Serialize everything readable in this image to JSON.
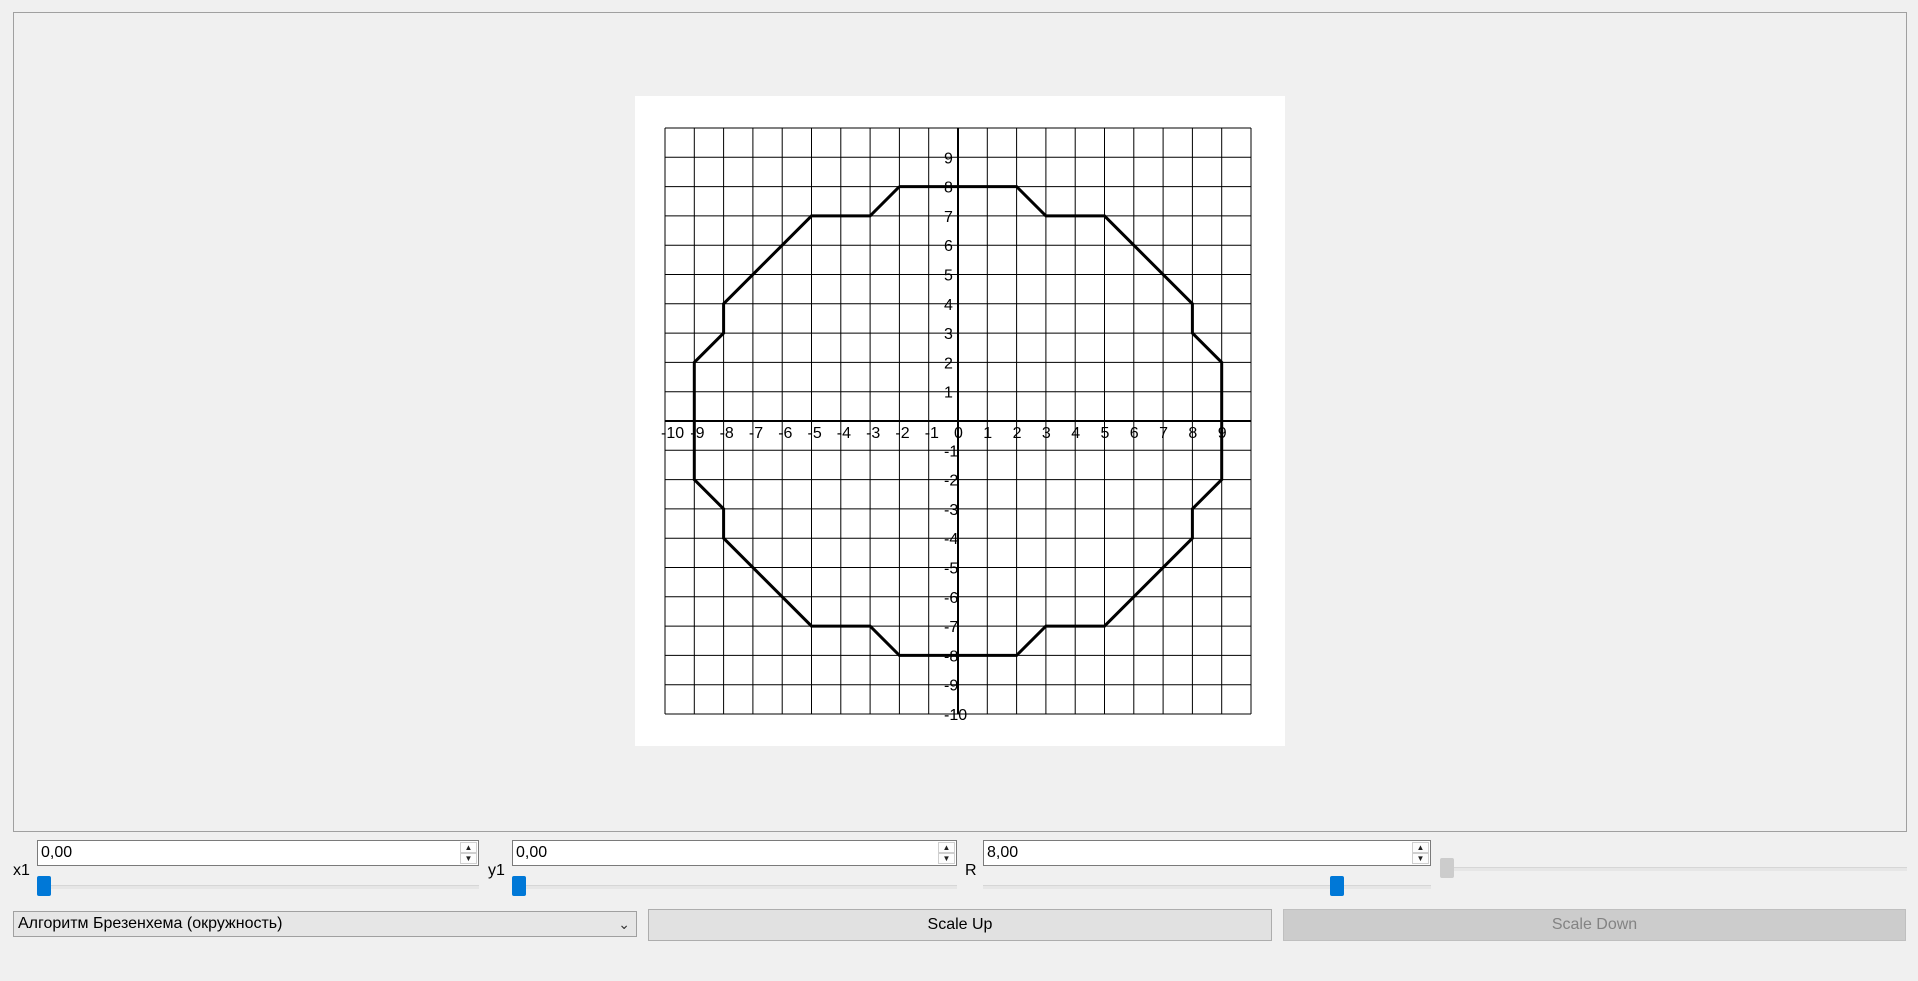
{
  "plot": {
    "axis_tick_labels_x": [
      "-10",
      "-9",
      "-8",
      "-7",
      "-6",
      "-5",
      "-4",
      "-3",
      "-2",
      "-1",
      "0",
      "1",
      "2",
      "3",
      "4",
      "5",
      "6",
      "7",
      "8",
      "9"
    ],
    "axis_tick_labels_y": [
      "9",
      "8",
      "7",
      "6",
      "5",
      "4",
      "3",
      "2",
      "1",
      "-1",
      "-2",
      "-3",
      "-4",
      "-5",
      "-6",
      "-7",
      "-8",
      "-9",
      "-10"
    ],
    "x_range": [
      -10,
      10
    ],
    "y_range": [
      -10,
      10
    ],
    "polygon_points": [
      [
        -2,
        8
      ],
      [
        2,
        8
      ],
      [
        3,
        7
      ],
      [
        5,
        7
      ],
      [
        8,
        4
      ],
      [
        8,
        3
      ],
      [
        9,
        2
      ],
      [
        9,
        -2
      ],
      [
        8,
        -3
      ],
      [
        8,
        -4
      ],
      [
        5,
        -7
      ],
      [
        3,
        -7
      ],
      [
        2,
        -8
      ],
      [
        -2,
        -8
      ],
      [
        -3,
        -7
      ],
      [
        -5,
        -7
      ],
      [
        -8,
        -4
      ],
      [
        -8,
        -3
      ],
      [
        -9,
        -2
      ],
      [
        -9,
        2
      ],
      [
        -8,
        3
      ],
      [
        -8,
        4
      ],
      [
        -5,
        7
      ],
      [
        -3,
        7
      ],
      [
        -2,
        8
      ]
    ],
    "grid_color": "#000000",
    "shape_color": "#000000"
  },
  "controls": {
    "x1": {
      "label": "x1",
      "value": "0,00",
      "slider_fraction": 0.0
    },
    "y1": {
      "label": "y1",
      "value": "0,00",
      "slider_fraction": 0.0
    },
    "r": {
      "label": "R",
      "value": "8,00",
      "slider_fraction": 0.8
    },
    "extra_slider_fraction": 0.0
  },
  "algorithm_select": {
    "selected": "Алгоритм Брезенхема (окружность)"
  },
  "buttons": {
    "scale_up": "Scale Up",
    "scale_down": "Scale Down"
  },
  "colors": {
    "accent": "#0078d7",
    "disabled": "#cccccc"
  }
}
